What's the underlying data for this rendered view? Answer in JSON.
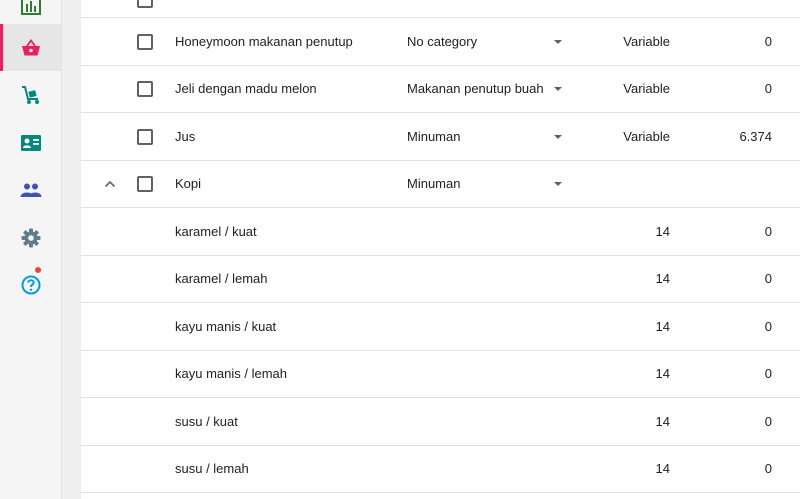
{
  "sidebar": {
    "items": [
      {
        "icon": "bar-chart-icon",
        "color": "#2e7d32",
        "active": false
      },
      {
        "icon": "basket-icon",
        "color": "#e91e63",
        "active": true
      },
      {
        "icon": "cart-delivery-icon",
        "color": "#00897b",
        "active": false
      },
      {
        "icon": "contact-card-icon",
        "color": "#00897b",
        "active": false
      },
      {
        "icon": "people-icon",
        "color": "#3f51b5",
        "active": false
      },
      {
        "icon": "gear-icon",
        "color": "#607d8b",
        "active": false
      },
      {
        "icon": "help-icon",
        "color": "#039be5",
        "active": false,
        "badge_color": "#f44336"
      }
    ]
  },
  "main": {
    "parent_rows": [
      {
        "name": "Honeymoon makanan penutup",
        "category": "No category",
        "price": "Variable",
        "stock": "0"
      },
      {
        "name": "Jeli dengan madu melon",
        "category": "Makanan penutup buah",
        "price": "Variable",
        "stock": "0"
      },
      {
        "name": "Jus",
        "category": "Minuman",
        "price": "Variable",
        "stock": "6.374"
      },
      {
        "name": "Kopi",
        "category": "Minuman",
        "price": "",
        "stock": "",
        "expanded": true
      }
    ],
    "variant_rows": [
      {
        "name": "karamel / kuat",
        "price": "14",
        "stock": "0"
      },
      {
        "name": "karamel / lemah",
        "price": "14",
        "stock": "0"
      },
      {
        "name": "kayu manis / kuat",
        "price": "14",
        "stock": "0"
      },
      {
        "name": "kayu manis / lemah",
        "price": "14",
        "stock": "0"
      },
      {
        "name": "susu / kuat",
        "price": "14",
        "stock": "0"
      },
      {
        "name": "susu / lemah",
        "price": "14",
        "stock": "0"
      }
    ]
  }
}
